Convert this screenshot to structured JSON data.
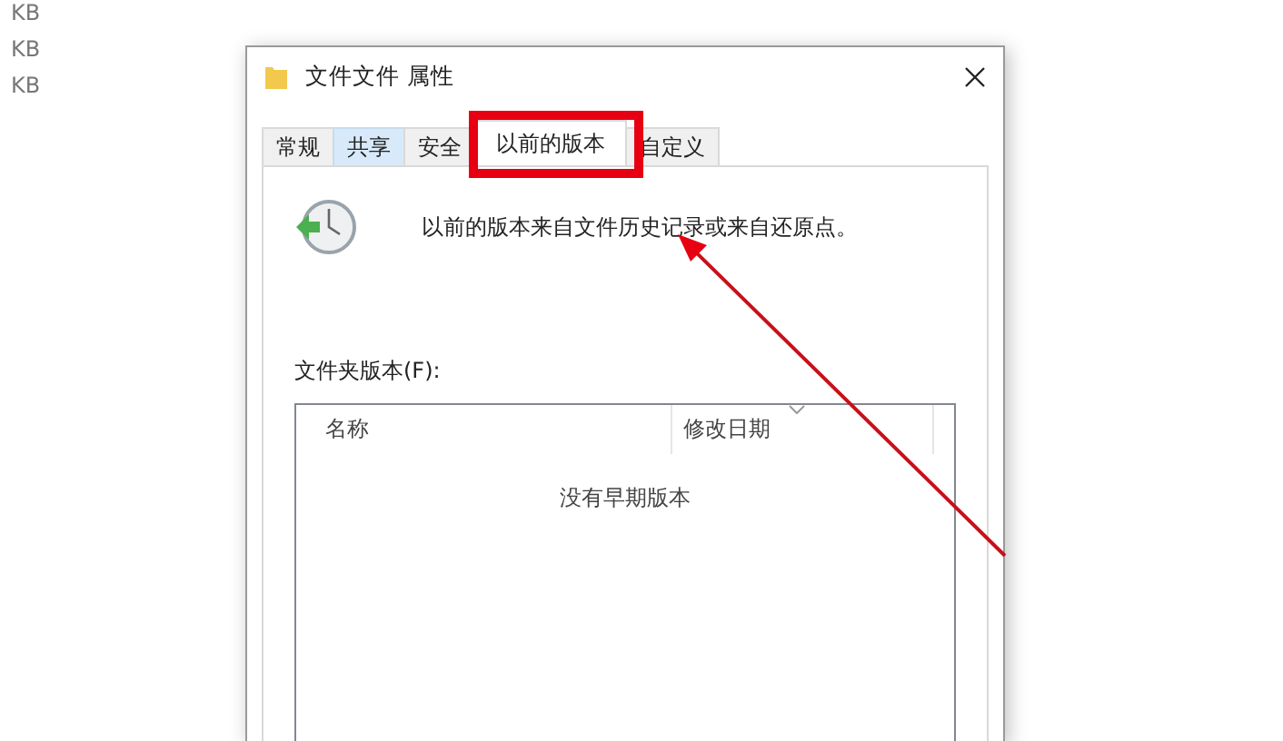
{
  "background_list": [
    "KB",
    "KB",
    "KB"
  ],
  "dialog": {
    "title": "文件文件 属性",
    "tabs": [
      {
        "label": "常规",
        "selected": false,
        "hovered": false,
        "annotated": false
      },
      {
        "label": "共享",
        "selected": false,
        "hovered": true,
        "annotated": false
      },
      {
        "label": "安全",
        "selected": false,
        "hovered": false,
        "annotated": false
      },
      {
        "label": "以前的版本",
        "selected": true,
        "hovered": false,
        "annotated": true
      },
      {
        "label": "自定义",
        "selected": false,
        "hovered": false,
        "annotated": false
      }
    ],
    "description": "以前的版本来自文件历史记录或来自还原点。",
    "versions_label": "文件夹版本(F):",
    "versions_table": {
      "columns": [
        {
          "label": "名称",
          "sorted": false
        },
        {
          "label": "修改日期",
          "sorted": true
        }
      ],
      "empty_text": "没有早期版本"
    }
  }
}
